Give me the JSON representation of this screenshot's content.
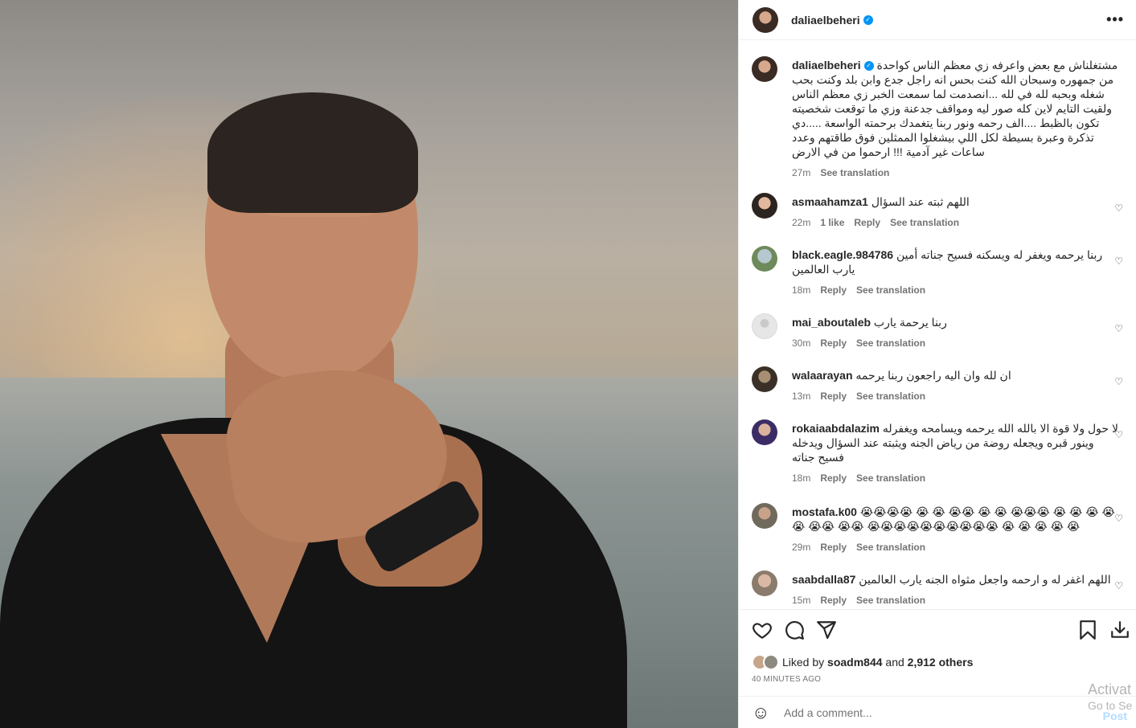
{
  "post": {
    "author": "daliaelbeheri",
    "caption": "مشتغلناش مع بعض واعرفه زي معظم الناس كواحدة من جمهوره وسبحان الله كنت بحس انه راجل جدع وابن بلد وكنت بحب شغله وبحبه لله في لله ...انصدمت لما سمعت الخبر زي معظم الناس ولقيت التايم لاين كله صور ليه ومواقف جدعنة وزي ما توقعت شخصيته تكون بالظبط ....الف رحمه ونور ربنا يتغمدك برحمته الواسعة .....دي تذكرة وعبرة بسيطة لكل اللي بيشغلوا الممثلين فوق طاقتهم وعدد ساعات غير آدمية !!! ارحموا من في الارض",
    "caption_time": "27m",
    "see_translation": "See translation"
  },
  "comments": [
    {
      "user": "asmaahamza1",
      "text": "اللهم ثبته عند السؤال",
      "time": "22m",
      "likes": "1 like",
      "reply": "Reply",
      "translate": "See translation"
    },
    {
      "user": "black.eagle.984786",
      "text": "ربنا يرحمه ويغفر له ويسكنه فسيح جناته أمين يارب العالمين",
      "time": "18m",
      "reply": "Reply",
      "translate": "See translation"
    },
    {
      "user": "mai_aboutaleb",
      "text": "ربنا يرحمة يارب",
      "time": "30m",
      "reply": "Reply",
      "translate": "See translation"
    },
    {
      "user": "walaarayan",
      "text": "ان لله وان اليه راجعون ربنا يرحمه",
      "time": "13m",
      "reply": "Reply",
      "translate": "See translation"
    },
    {
      "user": "rokaiaabdalazim",
      "text": "لا حول ولا قوة الا بالله الله يرحمه ويسامحه ويغفرله وينور قبره ويجعله روضة من رياض الجنه ويثبته عند السؤال ويدخله فسيح جناته",
      "time": "18m",
      "reply": "Reply",
      "translate": "See translation"
    },
    {
      "user": "mostafa.k00",
      "text": "😭😭😭😭 😭 😭 😭😭 😭 😭 😭😭😭 😭 😭 😭 😭😭 😭😭 😭😭 😭😭😭😭😭😭😭😭😭😭 😭 😭 😭 😭 😭",
      "time": "29m",
      "reply": "Reply",
      "translate": "See translation"
    },
    {
      "user": "saabdalla87",
      "text": "اللهم اغفر له و ارحمه واجعل مثواه الجنه يارب العالمين",
      "time": "15m",
      "reply": "Reply",
      "translate": "See translation"
    }
  ],
  "likes": {
    "prefix": "Liked by",
    "user": "soadm844",
    "and": "and",
    "others": "2,912 others"
  },
  "time_ago": "40 MINUTES AGO",
  "add_comment": {
    "placeholder": "Add a comment...",
    "post_label": "Post"
  },
  "watermark": {
    "line1": "Activat",
    "line2": "Go to Se"
  },
  "icons": {
    "more": "more-icon",
    "like": "heart-icon",
    "comment": "comment-icon",
    "share": "share-icon",
    "save": "bookmark-icon",
    "download": "download-icon",
    "emoji": "smile-icon"
  }
}
